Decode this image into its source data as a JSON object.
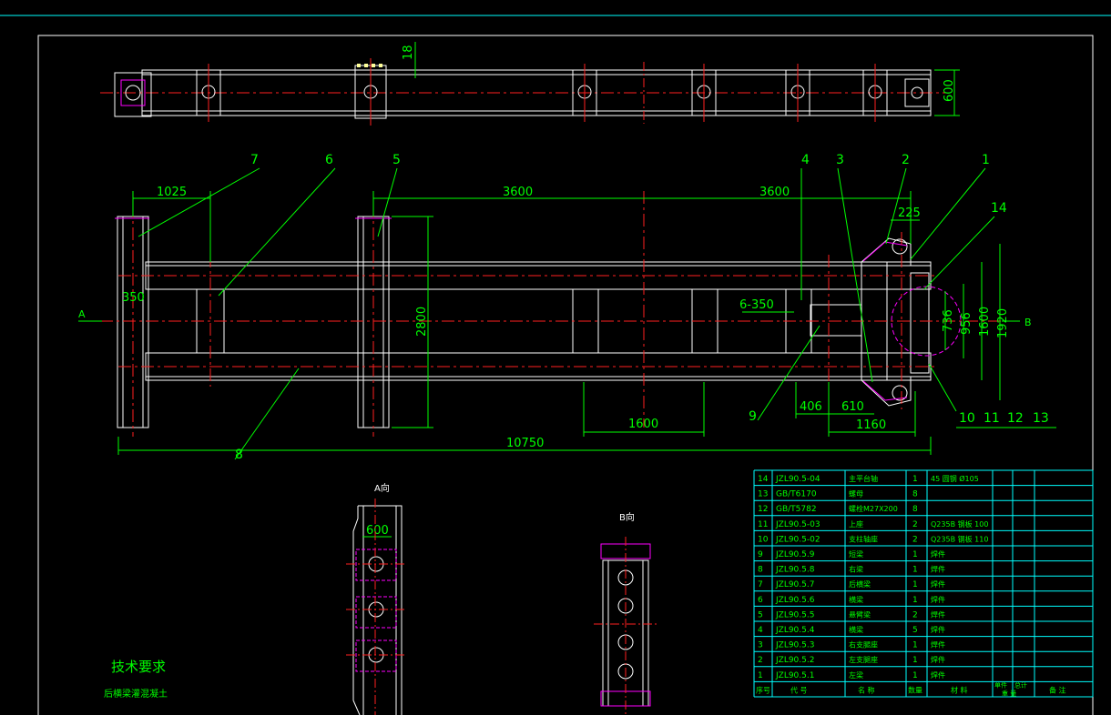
{
  "drawing": {
    "top_view": {
      "dim_thickness": "18",
      "dim_height": "600"
    },
    "front_view": {
      "dims": {
        "left_offset": "1025",
        "span_left": "3600",
        "span_right": "3600",
        "tab": "225",
        "left_small": "350",
        "spacing": "6-350",
        "height_total": "2800",
        "bottom_span": "1600",
        "d406": "406",
        "d610": "610",
        "d1160": "1160",
        "overall_length": "10750",
        "r_736": "736",
        "r_956": "956",
        "r_1600": "1600",
        "r_1920": "1920"
      },
      "balloons": [
        "7",
        "6",
        "5",
        "4",
        "3",
        "2",
        "1",
        "14",
        "9",
        "8",
        "10",
        "11",
        "12",
        "13"
      ],
      "view_arrow_left": "A",
      "view_arrow_right": "B"
    },
    "view_a": {
      "title": "A向",
      "dim_width": "600"
    },
    "view_b": {
      "title": "B向"
    },
    "notes": {
      "heading": "技术要求",
      "line1": "后横梁灌混凝土"
    }
  },
  "bom": {
    "rows": [
      {
        "no": "14",
        "code": "JZL90.5-04",
        "name": "主平台轴",
        "qty": "1",
        "material": "45 圆钢 Ø105",
        "remark": ""
      },
      {
        "no": "13",
        "code": "GB/T6170",
        "name": "螺母",
        "qty": "8",
        "material": "",
        "remark": ""
      },
      {
        "no": "12",
        "code": "GB/T5782",
        "name": "螺栓M27X200",
        "qty": "8",
        "material": "",
        "remark": ""
      },
      {
        "no": "11",
        "code": "JZL90.5-03",
        "name": "上座",
        "qty": "2",
        "material": "Q235B 钢板 100",
        "remark": ""
      },
      {
        "no": "10",
        "code": "JZL90.5-02",
        "name": "支柱轴座",
        "qty": "2",
        "material": "Q235B 钢板 110",
        "remark": ""
      },
      {
        "no": "9",
        "code": "JZL90.5.9",
        "name": "短梁",
        "qty": "1",
        "material": "焊件",
        "remark": ""
      },
      {
        "no": "8",
        "code": "JZL90.5.8",
        "name": "右梁",
        "qty": "1",
        "material": "焊件",
        "remark": ""
      },
      {
        "no": "7",
        "code": "JZL90.5.7",
        "name": "后横梁",
        "qty": "1",
        "material": "焊件",
        "remark": ""
      },
      {
        "no": "6",
        "code": "JZL90.5.6",
        "name": "横梁",
        "qty": "1",
        "material": "焊件",
        "remark": ""
      },
      {
        "no": "5",
        "code": "JZL90.5.5",
        "name": "悬臂梁",
        "qty": "2",
        "material": "焊件",
        "remark": ""
      },
      {
        "no": "4",
        "code": "JZL90.5.4",
        "name": "横梁",
        "qty": "5",
        "material": "焊件",
        "remark": ""
      },
      {
        "no": "3",
        "code": "JZL90.5.3",
        "name": "右支腿座",
        "qty": "1",
        "material": "焊件",
        "remark": ""
      },
      {
        "no": "2",
        "code": "JZL90.5.2",
        "name": "左支腿座",
        "qty": "1",
        "material": "焊件",
        "remark": ""
      },
      {
        "no": "1",
        "code": "JZL90.5.1",
        "name": "左梁",
        "qty": "1",
        "material": "焊件",
        "remark": ""
      }
    ],
    "header": {
      "no": "序号",
      "code": "代 号",
      "name": "名 称",
      "qty": "数量",
      "material": "材 料",
      "w1": "单件",
      "w2": "总计",
      "weight": "重 量",
      "remark": "备 注"
    }
  },
  "colors": {
    "line": "#ffffff",
    "center": "#ff0000",
    "dim": "#00ff00",
    "hidden": "#ff00ff",
    "frame": "#00ffff",
    "text": "#00ff00"
  }
}
